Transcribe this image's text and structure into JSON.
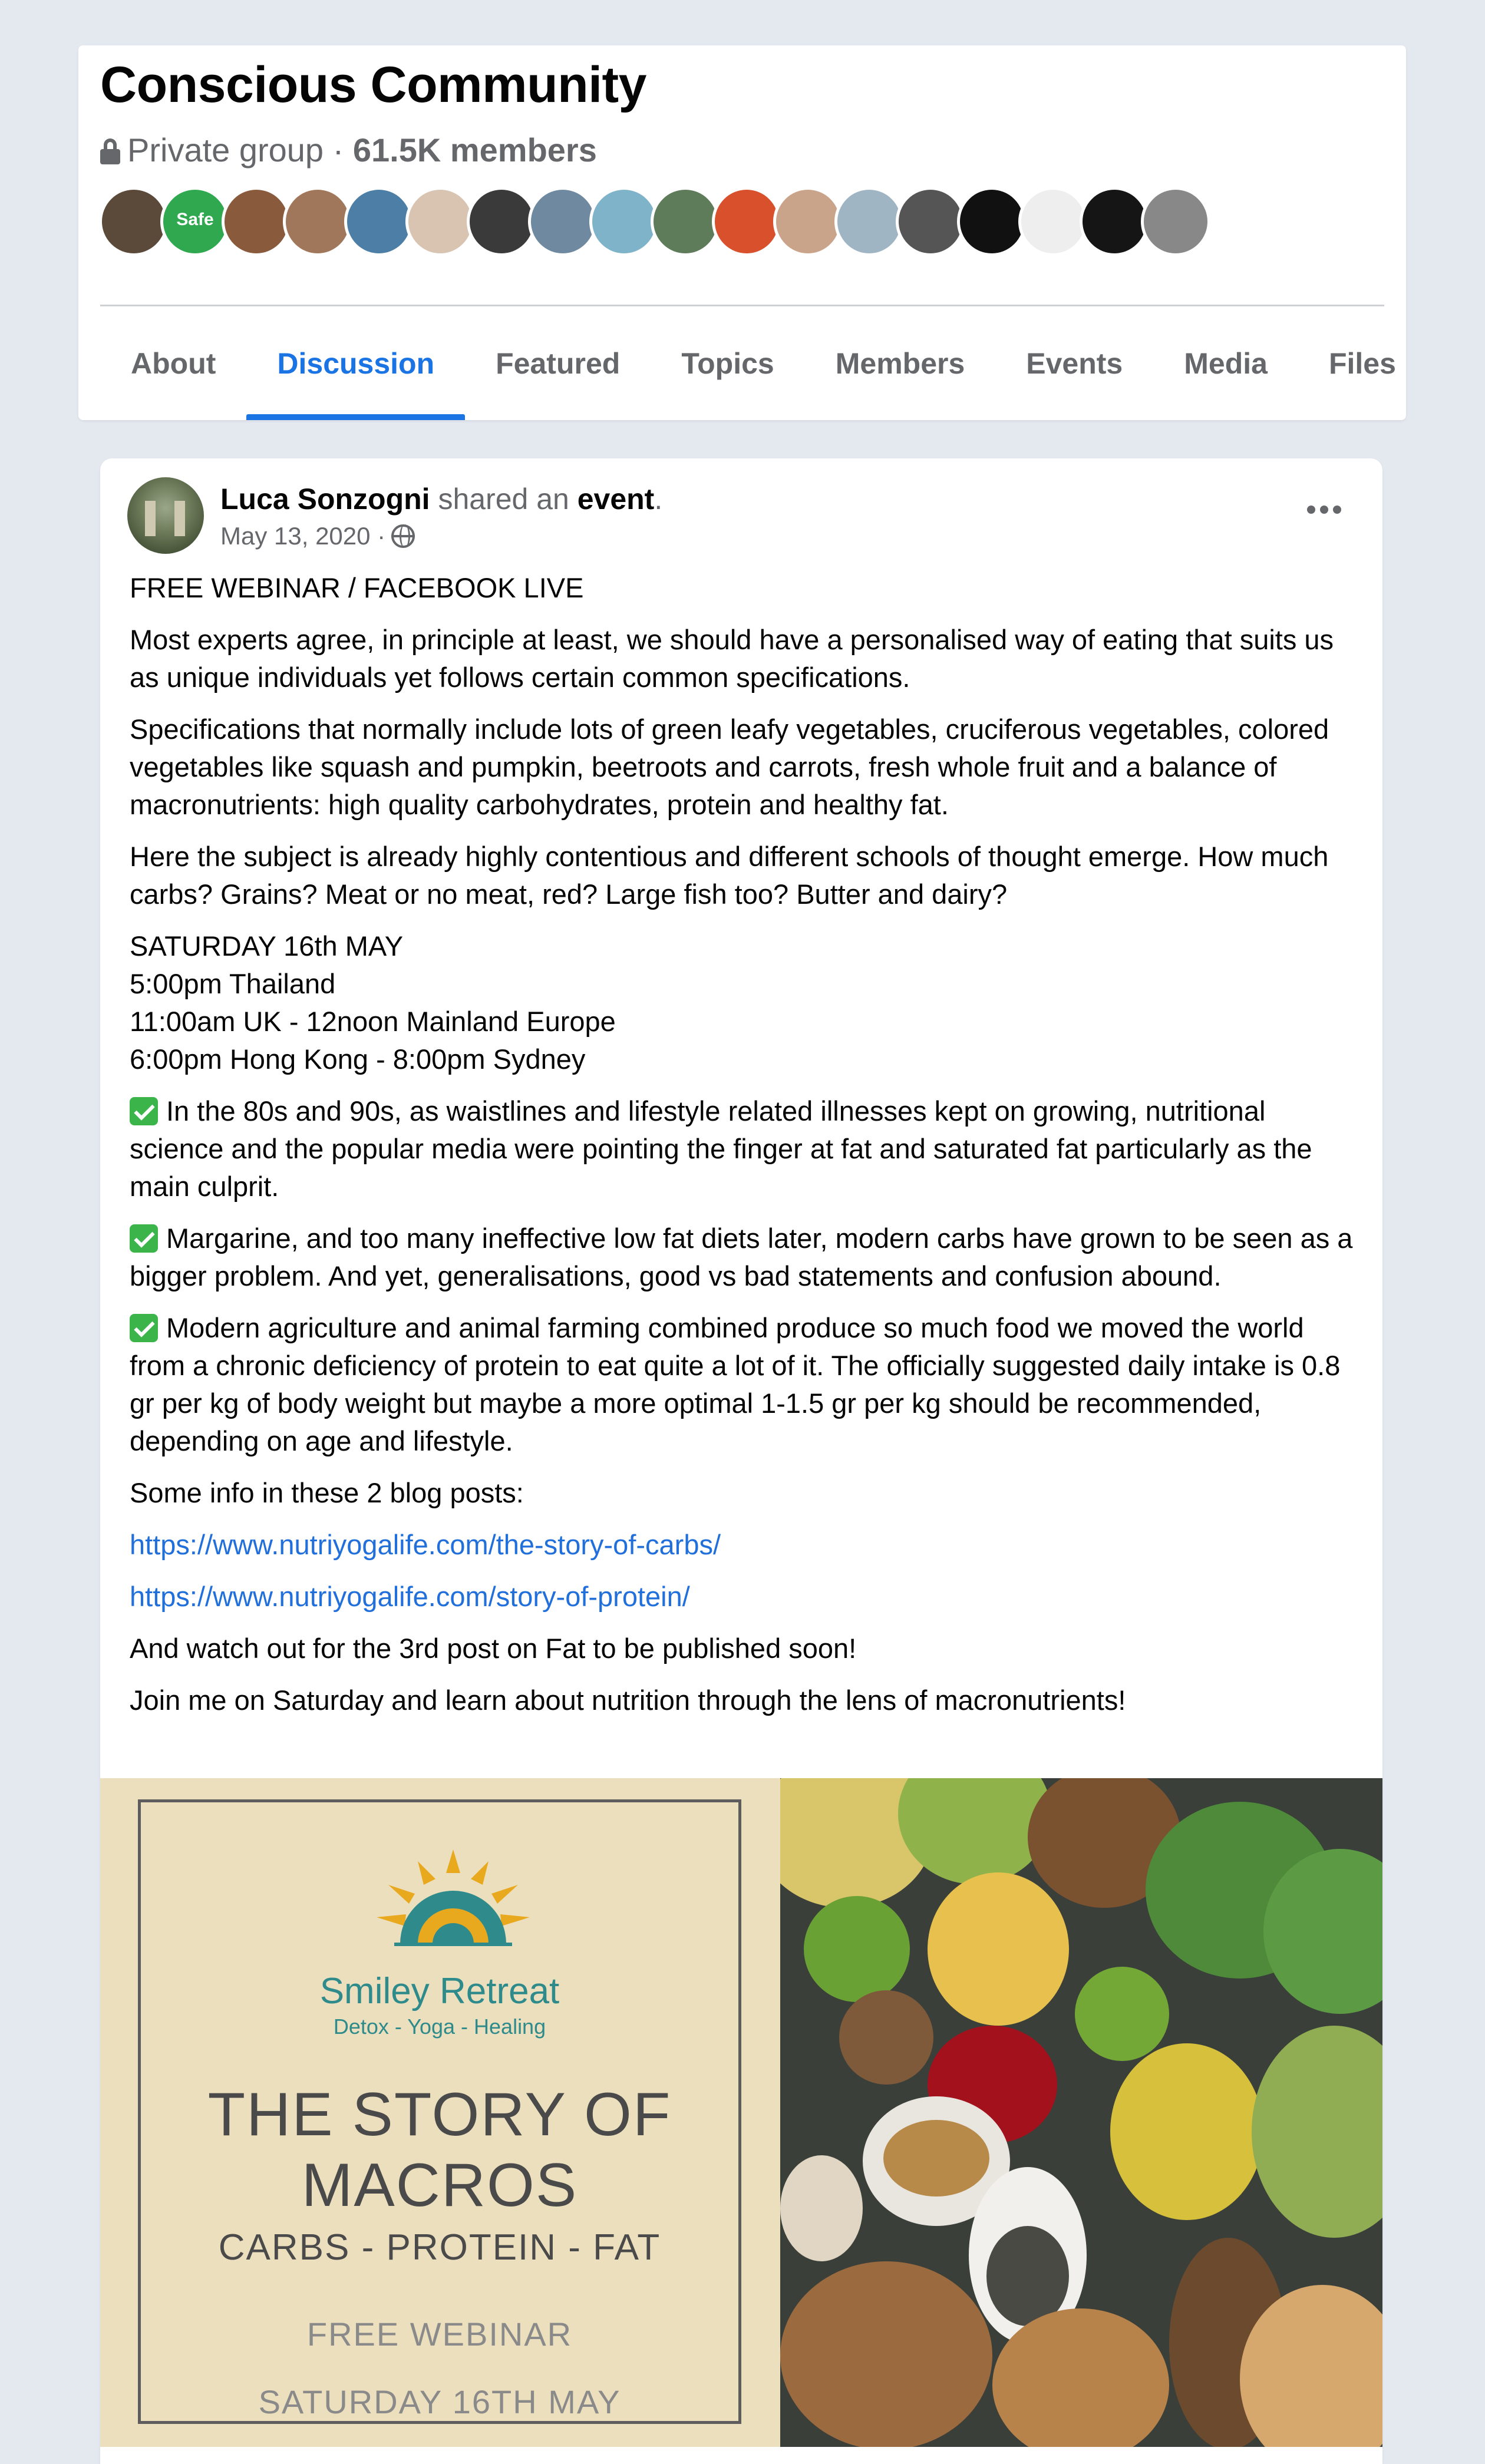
{
  "group": {
    "title": "Conscious Community",
    "privacy": "Private group ·",
    "members": "61.5K members",
    "avatars": [
      {
        "label": "",
        "color": "#5b4a3a"
      },
      {
        "label": "Safe",
        "color": "#2fa84f"
      },
      {
        "label": "",
        "color": "#8a5a3c"
      },
      {
        "label": "",
        "color": "#a0775a"
      },
      {
        "label": "",
        "color": "#4d7fa6"
      },
      {
        "label": "",
        "color": "#d8c4b0"
      },
      {
        "label": "",
        "color": "#3a3a3a"
      },
      {
        "label": "",
        "color": "#6f8aa0"
      },
      {
        "label": "",
        "color": "#7fb3c9"
      },
      {
        "label": "",
        "color": "#5e7c5a"
      },
      {
        "label": "",
        "color": "#d9502c"
      },
      {
        "label": "",
        "color": "#c9a48a"
      },
      {
        "label": "",
        "color": "#9fb5c4"
      },
      {
        "label": "",
        "color": "#555555"
      },
      {
        "label": "",
        "color": "#111111"
      },
      {
        "label": "",
        "color": "#eeeeee"
      },
      {
        "label": "",
        "color": "#151515"
      },
      {
        "label": "",
        "color": "#888888"
      }
    ]
  },
  "tabs": [
    {
      "label": "About",
      "active": false
    },
    {
      "label": "Discussion",
      "active": true
    },
    {
      "label": "Featured",
      "active": false
    },
    {
      "label": "Topics",
      "active": false
    },
    {
      "label": "Members",
      "active": false
    },
    {
      "label": "Events",
      "active": false
    },
    {
      "label": "Media",
      "active": false
    },
    {
      "label": "Files",
      "active": false
    }
  ],
  "post": {
    "author": "Luca Sonzogni",
    "action": " shared an ",
    "object": "event",
    "period": ".",
    "date": "May 13, 2020 ·",
    "heading": "FREE WEBINAR / FACEBOOK LIVE",
    "p1": "Most experts agree, in principle at least, we should have a personalised way of eating that suits us as unique individuals yet follows certain common specifications.",
    "p2": "Specifications that normally include lots of green leafy vegetables, cruciferous vegetables, colored vegetables like squash and pumpkin, beetroots and carrots, fresh whole fruit and a balance of macronutrients: high quality carbohydrates, protein and healthy fat.",
    "p3": "Here the subject is already highly contentious and different schools of thought emerge. How much carbs? Grains? Meat or no meat, red? Large fish too? Butter and dairy?",
    "schedule": [
      "SATURDAY 16th MAY",
      "5:00pm Thailand",
      "11:00am UK - 12noon Mainland Europe",
      "6:00pm Hong Kong - 8:00pm Sydney"
    ],
    "bullet1": "In the 80s and 90s, as waistlines and lifestyle related illnesses kept on growing, nutritional science and the popular media were pointing the finger at fat and saturated fat particularly as the main culprit.",
    "bullet2": "Margarine, and too many ineffective low fat diets later, modern carbs have grown to be seen as a bigger problem. And yet, generalisations, good vs bad statements and confusion abound.",
    "bullet3": "Modern agriculture and animal farming combined produce so much food we moved the world from a chronic deficiency of protein to eat quite a lot of it. The officially suggested daily intake is 0.8 gr per kg of body weight but maybe a more optimal 1-1.5 gr per kg should be recommended, depending on age and lifestyle.",
    "blog_intro": "Some info in these 2 blog posts:",
    "link1": "https://www.nutriyogalife.com/the-story-of-carbs/",
    "link2": "https://www.nutriyogalife.com/story-of-protein/",
    "p_watch": "And watch out for the 3rd post on Fat to be published soon!",
    "p_join": "Join me on Saturday and learn about nutrition through the lens of macronutrients!"
  },
  "poster": {
    "brand": "Smiley Retreat",
    "brand_sub": "Detox - Yoga - Healing",
    "title_line1": "THE STORY OF",
    "title_line2": "MACROS",
    "subtitle": "CARBS - PROTEIN - FAT",
    "free": "FREE WEBINAR",
    "date": "SATURDAY 16TH MAY"
  },
  "colors": {
    "accent": "#1b74e4",
    "link": "#216fdb",
    "check": "#3bb54a",
    "poster_bg": "#ecdfbd",
    "brand_teal": "#2f8b8b"
  }
}
